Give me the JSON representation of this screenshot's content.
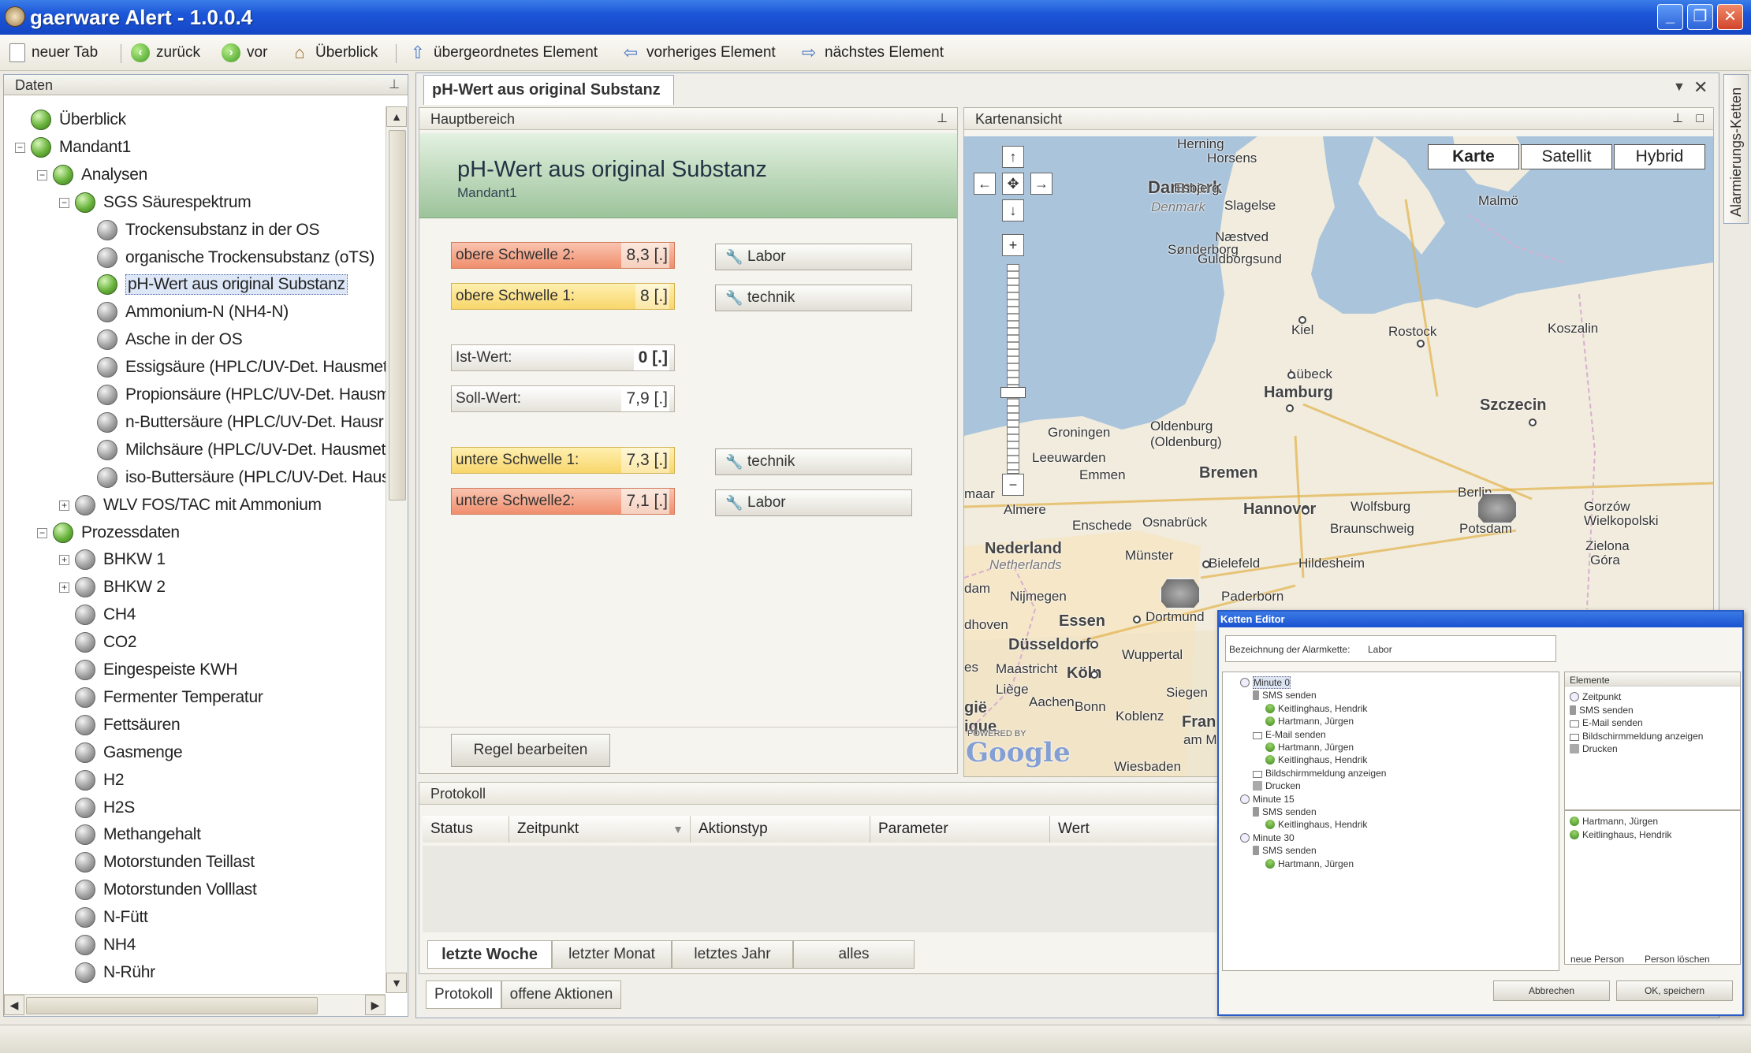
{
  "window": {
    "title": "gaerware Alert - 1.0.0.4"
  },
  "toolbar": {
    "new_tab": "neuer Tab",
    "back": "zurück",
    "forward": "vor",
    "overview": "Überblick",
    "parent": "übergeordnetes Element",
    "previous": "vorheriges Element",
    "next": "nächstes Element"
  },
  "left_panel": {
    "title": "Daten",
    "tree": [
      {
        "label": "Überblick",
        "status": "green",
        "level": 0
      },
      {
        "label": "Mandant1",
        "status": "green",
        "level": 0,
        "expander": "−"
      },
      {
        "label": "Analysen",
        "status": "green",
        "level": 1,
        "expander": "−"
      },
      {
        "label": "SGS Säurespektrum",
        "status": "green",
        "level": 2,
        "expander": "−"
      },
      {
        "label": "Trockensubstanz in der OS",
        "status": "gray",
        "level": 3
      },
      {
        "label": "organische Trockensubstanz (oTS)",
        "status": "gray",
        "level": 3
      },
      {
        "label": "pH-Wert aus original Substanz",
        "status": "green",
        "level": 3,
        "selected": true
      },
      {
        "label": "Ammonium-N (NH4-N)",
        "status": "gray",
        "level": 3
      },
      {
        "label": "Asche in der OS",
        "status": "gray",
        "level": 3
      },
      {
        "label": "Essigsäure (HPLC/UV-Det. Hausmeth",
        "status": "gray",
        "level": 3
      },
      {
        "label": "Propionsäure (HPLC/UV-Det. Hausm",
        "status": "gray",
        "level": 3
      },
      {
        "label": "n-Buttersäure (HPLC/UV-Det. Hausr",
        "status": "gray",
        "level": 3
      },
      {
        "label": "Milchsäure (HPLC/UV-Det. Hausmeth",
        "status": "gray",
        "level": 3
      },
      {
        "label": "iso-Buttersäure (HPLC/UV-Det. Haus",
        "status": "gray",
        "level": 3
      },
      {
        "label": "WLV FOS/TAC mit Ammonium",
        "status": "gray",
        "level": 2,
        "expander": "+"
      },
      {
        "label": "Prozessdaten",
        "status": "green",
        "level": 1,
        "expander": "−"
      },
      {
        "label": "BHKW 1",
        "status": "gray",
        "level": 2,
        "expander": "+"
      },
      {
        "label": "BHKW 2",
        "status": "gray",
        "level": 2,
        "expander": "+"
      },
      {
        "label": "CH4",
        "status": "gray",
        "level": 2
      },
      {
        "label": "CO2",
        "status": "gray",
        "level": 2
      },
      {
        "label": "Eingespeiste KWH",
        "status": "gray",
        "level": 2
      },
      {
        "label": "Fermenter Temperatur",
        "status": "gray",
        "level": 2
      },
      {
        "label": "Fettsäuren",
        "status": "gray",
        "level": 2
      },
      {
        "label": "Gasmenge",
        "status": "gray",
        "level": 2
      },
      {
        "label": "H2",
        "status": "gray",
        "level": 2
      },
      {
        "label": "H2S",
        "status": "gray",
        "level": 2
      },
      {
        "label": "Methangehalt",
        "status": "gray",
        "level": 2
      },
      {
        "label": "Motorstunden Teillast",
        "status": "gray",
        "level": 2
      },
      {
        "label": "Motorstunden Volllast",
        "status": "gray",
        "level": 2
      },
      {
        "label": "N-Fütt",
        "status": "gray",
        "level": 2
      },
      {
        "label": "NH4",
        "status": "gray",
        "level": 2
      },
      {
        "label": "N-Rühr",
        "status": "gray",
        "level": 2
      }
    ]
  },
  "document": {
    "tab_title": "pH-Wert aus original Substanz"
  },
  "haupt": {
    "title": "Hauptbereich",
    "heading": "pH-Wert aus original Substanz",
    "subheading": "Mandant1",
    "fields": {
      "upper2": {
        "label": "obere Schwelle 2:",
        "value": "8,3 [.]"
      },
      "upper1": {
        "label": "obere Schwelle 1:",
        "value": "8 [.]"
      },
      "ist": {
        "label": "Ist-Wert:",
        "value": "0 [.]"
      },
      "soll": {
        "label": "Soll-Wert:",
        "value": "7,9 [.]"
      },
      "lower1": {
        "label": "untere Schwelle 1:",
        "value": "7,3 [.]"
      },
      "lower2": {
        "label": "untere Schwelle2:",
        "value": "7,1 [.]"
      }
    },
    "actions": {
      "labor1": "Labor",
      "technik1": "technik",
      "technik2": "technik",
      "labor2": "Labor"
    },
    "edit_rule": "Regel bearbeiten"
  },
  "map": {
    "title": "Kartenansicht",
    "types": [
      "Karte",
      "Satellit",
      "Hybrid"
    ],
    "powered": "POWERED BY",
    "google": "Google"
  },
  "protokoll": {
    "title": "Protokoll",
    "columns": [
      "Status",
      "Zeitpunkt",
      "Aktionstyp",
      "Parameter",
      "Wert"
    ],
    "ranges": [
      "letzte Woche",
      "letzter Monat",
      "letztes Jahr",
      "alles"
    ],
    "bottom_tabs": [
      "Protokoll",
      "offene Aktionen"
    ]
  },
  "editor": {
    "title": "Ketten Editor",
    "name_label": "Bezeichnung der Alarmkette:",
    "name_value": "Labor",
    "tree": [
      {
        "label": "Minute 0",
        "icon": "clock",
        "indent": 0
      },
      {
        "label": "SMS senden",
        "icon": "phone",
        "indent": 1
      },
      {
        "label": "Keitlinghaus, Hendrik",
        "icon": "person",
        "indent": 2
      },
      {
        "label": "Hartmann, Jürgen",
        "icon": "person",
        "indent": 2
      },
      {
        "label": "E-Mail senden",
        "icon": "mail",
        "indent": 1
      },
      {
        "label": "Hartmann, Jürgen",
        "icon": "person",
        "indent": 2
      },
      {
        "label": "Keitlinghaus, Hendrik",
        "icon": "person",
        "indent": 2
      },
      {
        "label": "Bildschirmmeldung anzeigen",
        "icon": "mail",
        "indent": 1
      },
      {
        "label": "Drucken",
        "icon": "print",
        "indent": 1
      },
      {
        "label": "Minute 15",
        "icon": "clock",
        "indent": 0
      },
      {
        "label": "SMS senden",
        "icon": "phone",
        "indent": 1
      },
      {
        "label": "Keitlinghaus, Hendrik",
        "icon": "person",
        "indent": 2
      },
      {
        "label": "Minute 30",
        "icon": "clock",
        "indent": 0
      },
      {
        "label": "SMS senden",
        "icon": "phone",
        "indent": 1
      },
      {
        "label": "Hartmann, Jürgen",
        "icon": "person",
        "indent": 2
      }
    ],
    "elements_title": "Elemente",
    "elements": [
      {
        "label": "Zeitpunkt",
        "icon": "clock"
      },
      {
        "label": "SMS senden",
        "icon": "phone"
      },
      {
        "label": "E-Mail senden",
        "icon": "mail"
      },
      {
        "label": "Bildschirmmeldung anzeigen",
        "icon": "mail"
      },
      {
        "label": "Drucken",
        "icon": "print"
      }
    ],
    "persons": [
      {
        "label": "Hartmann, Jürgen",
        "icon": "person"
      },
      {
        "label": "Keitlinghaus, Hendrik",
        "icon": "person"
      }
    ],
    "new_person": "neue Person",
    "delete_person": "Person löschen",
    "cancel": "Abbrechen",
    "save": "OK, speichern"
  },
  "side_tab": "Alarmierungs-Ketten"
}
